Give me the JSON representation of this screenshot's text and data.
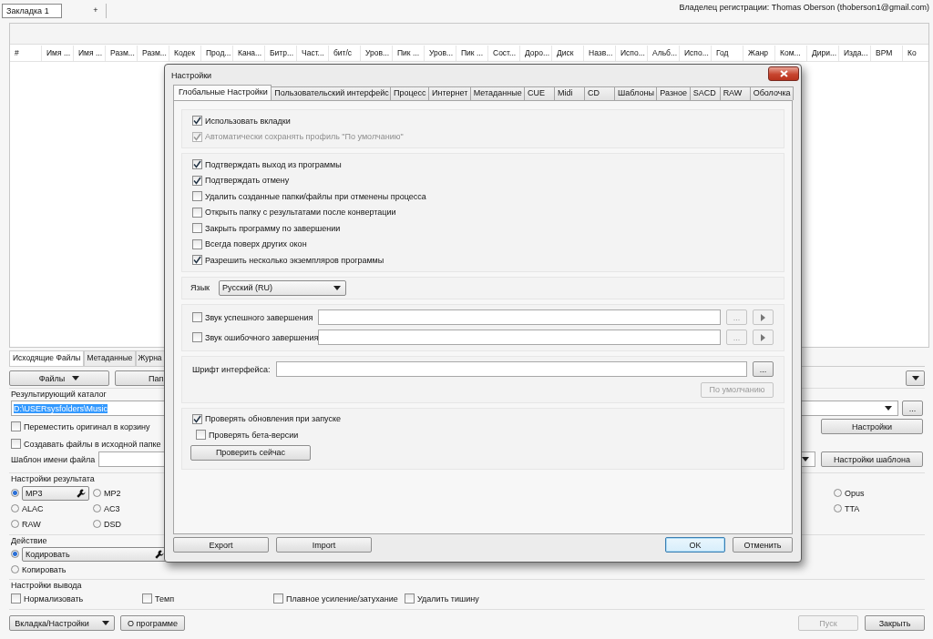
{
  "document_tabs": [
    {
      "label": "Закладка 1",
      "selected": true
    }
  ],
  "new_tab_button": "+",
  "owner": "Владелец регистрации: Thomas Oberson (thoberson1@gmail.com)",
  "file_list": {
    "columns": [
      "#",
      "Имя ...",
      "Имя ...",
      "Разм...",
      "Разм...",
      "Кодек",
      "Прод...",
      "Кана...",
      "Битр...",
      "Част...",
      "бит/с",
      "Уров...",
      "Пик ...",
      "Уров...",
      "Пик ...",
      "Сост...",
      "Доро...",
      "Диск",
      "Назв...",
      "Испо...",
      "Альб...",
      "Испо...",
      "Год",
      "Жанр",
      "Ком...",
      "Дири...",
      "Изда...",
      "BPM",
      "Ко"
    ]
  },
  "source_tabs": [
    {
      "label": "Исходящие Файлы",
      "selected": true
    },
    {
      "label": "Метаданные",
      "selected": false
    },
    {
      "label": "Журна",
      "selected": false
    }
  ],
  "source_buttons": [
    {
      "label": "Файлы",
      "kind": "dropdown"
    },
    {
      "label": "Пап",
      "kind": "button"
    }
  ],
  "output_folder": {
    "label": "Результирующий каталог",
    "value": "D:\\USERsysfolders\\Music",
    "browse_button": "..."
  },
  "folder_options": [
    {
      "label": "Переместить оригинал в корзину",
      "checked": false
    },
    {
      "label": "Создавать файлы в исходной папке",
      "checked": false
    }
  ],
  "settings_button": "Настройки",
  "filename_template": {
    "label": "Шаблон имени файла",
    "button": "Настройки шаблона"
  },
  "output_settings": {
    "title": "Настройки результата",
    "format_columns": [
      [
        {
          "label": "MP3",
          "selected": true
        },
        {
          "label": "ALAC",
          "selected": false
        },
        {
          "label": "RAW",
          "selected": false
        }
      ],
      [
        {
          "label": "MP2",
          "selected": false
        },
        {
          "label": "AC3",
          "selected": false
        },
        {
          "label": "DSD",
          "selected": false
        }
      ],
      [
        {
          "label": "Opus",
          "selected": false
        },
        {
          "label": "TTA",
          "selected": false
        }
      ]
    ]
  },
  "action": {
    "title": "Действие",
    "items": [
      {
        "label": "Кодировать",
        "selected": true
      },
      {
        "label": "Копировать",
        "selected": false
      }
    ]
  },
  "output_options": {
    "title": "Настройки вывода",
    "items": [
      {
        "label": "Нормализовать",
        "checked": false
      },
      {
        "label": "Темп",
        "checked": false
      },
      {
        "label": "Плавное усиление/затухание",
        "checked": false
      },
      {
        "label": "Удалить тишину",
        "checked": false
      }
    ]
  },
  "bottom_left_buttons": [
    {
      "label": "Вкладка/Настройки",
      "kind": "dropdown"
    },
    {
      "label": "О программе",
      "kind": "button"
    }
  ],
  "bottom_right_buttons": [
    {
      "label": "Пуск",
      "disabled": true
    },
    {
      "label": "Закрыть",
      "disabled": false
    }
  ],
  "dialog": {
    "title": "Настройки",
    "tabs": [
      {
        "label": "Глобальные Настройки",
        "selected": true
      },
      {
        "label": "Пользовательский интерфейс",
        "selected": false
      },
      {
        "label": "Процесс",
        "selected": false
      },
      {
        "label": "Интернет",
        "selected": false
      },
      {
        "label": "Метаданные",
        "selected": false
      },
      {
        "label": "CUE",
        "selected": false
      },
      {
        "label": "Midi",
        "selected": false
      },
      {
        "label": "CD",
        "selected": false
      },
      {
        "label": "Шаблоны",
        "selected": false
      },
      {
        "label": "Разное",
        "selected": false
      },
      {
        "label": "SACD",
        "selected": false
      },
      {
        "label": "RAW",
        "selected": false
      },
      {
        "label": "Оболочка",
        "selected": false
      }
    ],
    "general": [
      {
        "label": "Использовать вкладки",
        "checked": true,
        "disabled": false
      },
      {
        "label": "Автоматически сохранять профиль \"По умолчанию\"",
        "checked": true,
        "disabled": true
      }
    ],
    "behaviour": [
      {
        "label": "Подтверждать выход из программы",
        "checked": true
      },
      {
        "label": "Подтверждать отмену",
        "checked": true
      },
      {
        "label": "Удалить созданные папки/файлы при отменены процесса",
        "checked": false
      },
      {
        "label": "Открыть папку с результатами после конвертации",
        "checked": false
      },
      {
        "label": "Закрыть программу по завершении",
        "checked": false
      },
      {
        "label": "Всегда поверх других окон",
        "checked": false
      },
      {
        "label": "Разрешить несколько экземпляров программы",
        "checked": true
      }
    ],
    "language": {
      "label": "Язык",
      "value": "Русский (RU)"
    },
    "sounds": [
      {
        "label": "Звук успешного завершения",
        "checked": false,
        "browse": "...",
        "buttons_disabled": true
      },
      {
        "label": "Звук ошибочного завершения",
        "checked": false,
        "browse": "...",
        "buttons_disabled": true
      }
    ],
    "font": {
      "label": "Шрифт интерфейса:",
      "browse": "...",
      "default_button": {
        "label": "По умолчанию",
        "disabled": true
      }
    },
    "updates": [
      {
        "label": "Проверять обновления при запуске",
        "checked": true,
        "children": [
          {
            "label": "Проверять бета-версии",
            "checked": false
          }
        ]
      }
    ],
    "check_now_button": "Проверить сейчас",
    "left_buttons": [
      "Export",
      "Import"
    ],
    "right_buttons": [
      {
        "label": "OK",
        "default": true
      },
      {
        "label": "Отменить",
        "default": false
      }
    ]
  }
}
